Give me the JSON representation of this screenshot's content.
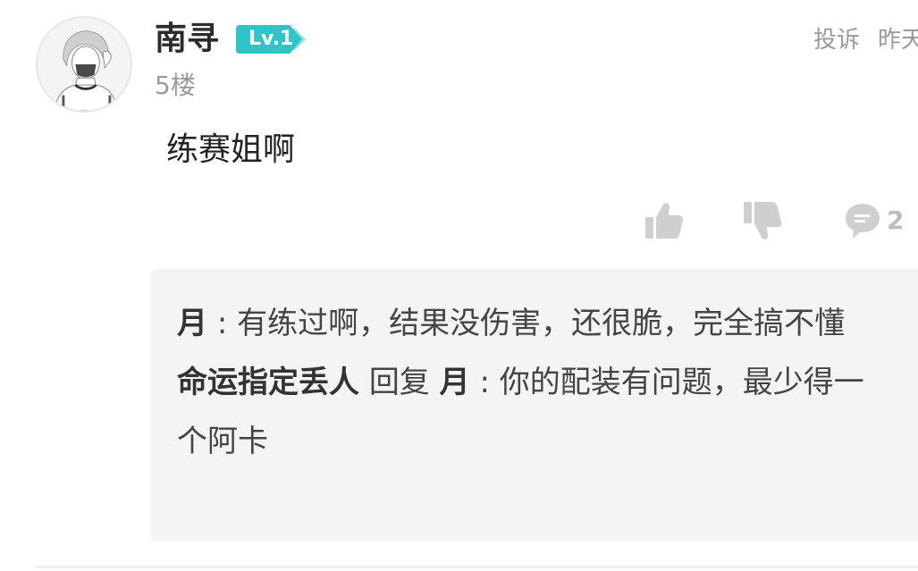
{
  "comment": {
    "username": "南寻",
    "level": "Lv.1",
    "floor": "5楼",
    "report": "投诉",
    "time": "昨天",
    "text": "练赛姐啊"
  },
  "actions": {
    "like_icon": "thumbs-up-icon",
    "dislike_icon": "thumbs-down-icon",
    "reply_icon": "comment-bubble-icon",
    "reply_count": "2"
  },
  "replies": [
    {
      "author": "月",
      "separator": ":",
      "text": "有练过啊，结果没伤害，还很脆，完全搞不懂"
    },
    {
      "author": "命运指定丢人",
      "reply_word": "回复",
      "target": "月",
      "separator": ":",
      "text": "你的配装有问题，最少得一个阿卡"
    }
  ],
  "colors": {
    "badge": "#2fc4c8",
    "muted": "#9a9a9a",
    "icon": "#cfcfcf",
    "reply_bg": "#f4f4f4"
  }
}
